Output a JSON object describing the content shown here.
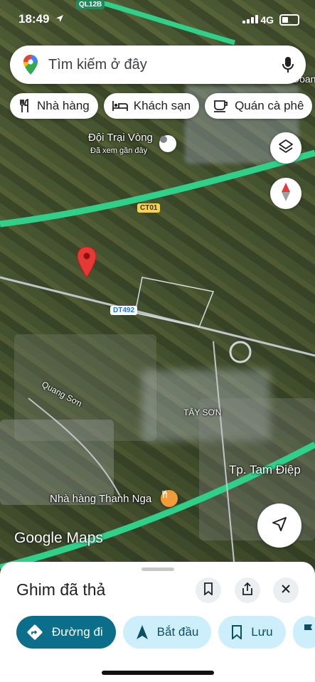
{
  "status_bar": {
    "time": "18:49",
    "network": "4G"
  },
  "search": {
    "placeholder": "Tìm kiếm ở đây"
  },
  "chips": [
    {
      "label": "Nhà hàng",
      "icon": "restaurant-icon"
    },
    {
      "label": "Khách sạn",
      "icon": "hotel-icon"
    },
    {
      "label": "Quán cà phê",
      "icon": "coffee-icon"
    }
  ],
  "map": {
    "places": {
      "doi_trai_vong": "Đội Trại Vòng",
      "doi_trai_vong_sub": "Đã xem gần đây",
      "doan_nhan_partial": "Doan Nhan",
      "quang_son": "Quang Sơn",
      "tay_son": "TÂY SƠN",
      "tam_diep": "Tp. Tam Điệp",
      "restaurant": "Nhà hàng Thanh Nga"
    },
    "roads": {
      "ql12b": "QL12B",
      "ct01": "CT01",
      "dt492": "DT492"
    },
    "attribution": "Google Maps",
    "colors": {
      "highway": "#2fd08a",
      "pin": "#e53935",
      "restaurant": "#f29b38"
    }
  },
  "sheet": {
    "title": "Ghim đã thả",
    "actions": [
      {
        "label": "Đường đi",
        "icon": "directions-icon"
      },
      {
        "label": "Bắt đầu",
        "icon": "navigation-arrow-icon"
      },
      {
        "label": "Lưu",
        "icon": "bookmark-icon"
      }
    ],
    "accent": "#0b6e8a"
  }
}
